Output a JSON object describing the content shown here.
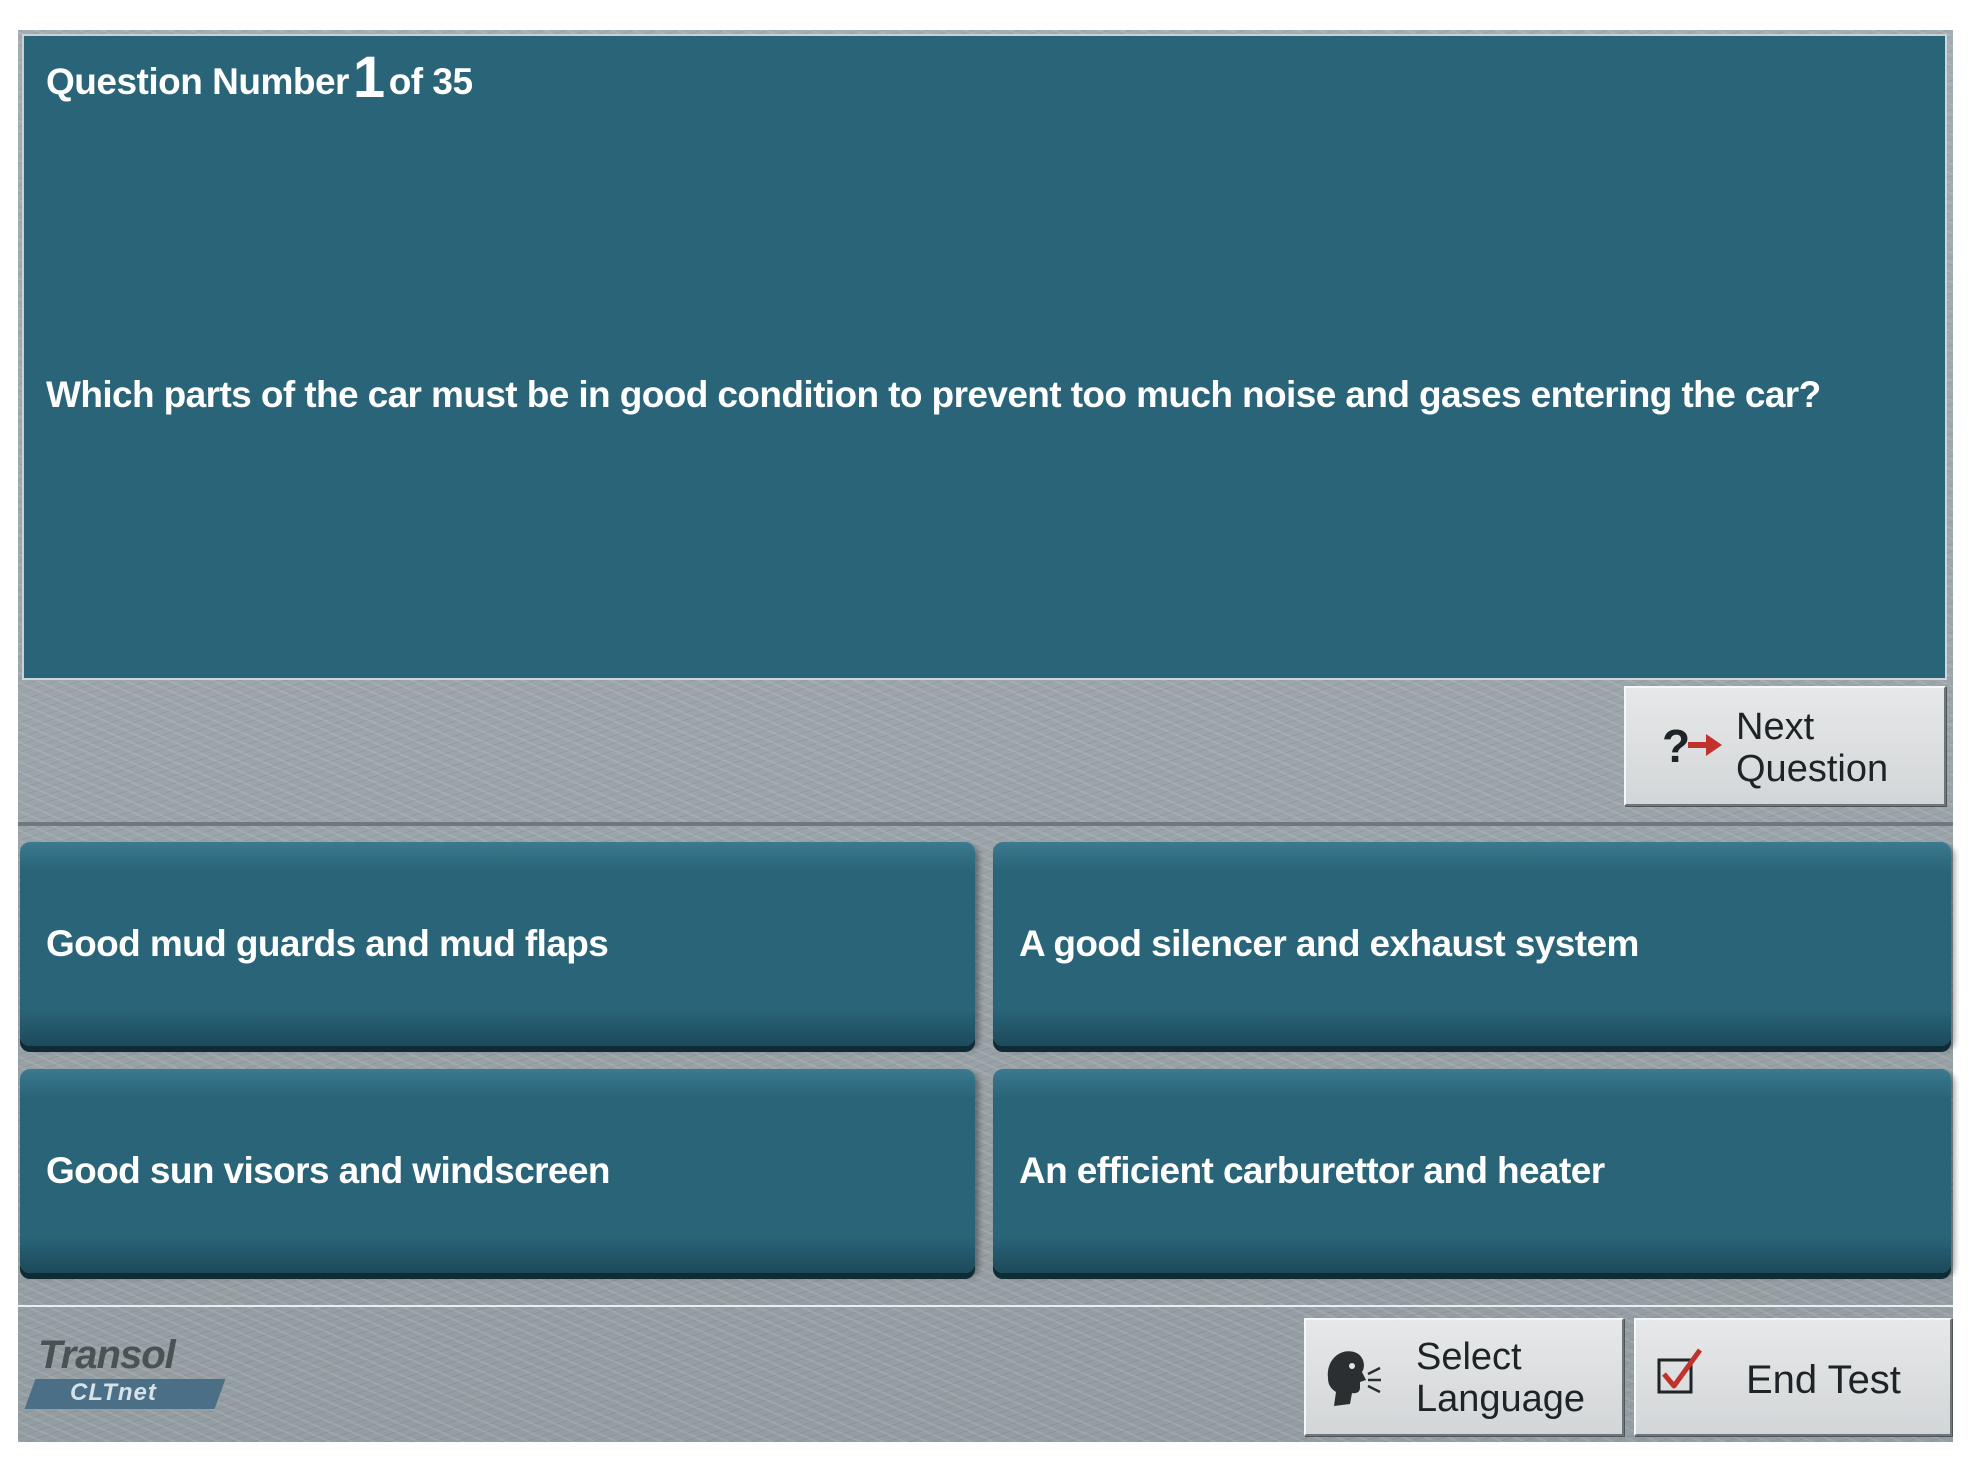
{
  "question": {
    "label_prefix": "Question Number",
    "current": "1",
    "label_of": "of 35",
    "text": "Which parts of the car must be in good condition to prevent too much noise and gases entering the car?"
  },
  "next_button": {
    "line1": "Next",
    "line2": "Question",
    "icon": "question-arrow-icon"
  },
  "answers": [
    {
      "text": "Good mud guards and mud flaps"
    },
    {
      "text": "A good silencer and exhaust system"
    },
    {
      "text": "Good sun visors and windscreen"
    },
    {
      "text": "An efficient carburettor and heater"
    }
  ],
  "footer": {
    "logo_top": "Transol",
    "logo_bottom": "CLTnet",
    "select_language": {
      "line1": "Select",
      "line2": "Language",
      "icon": "speaking-head-icon"
    },
    "end_test": {
      "label": "End Test",
      "icon": "checkbox-checked-icon"
    }
  },
  "colors": {
    "panel": "#2a6479",
    "button_gray": "#d3d6d8",
    "arrow_red": "#c0322b",
    "check_red": "#c0322b"
  }
}
